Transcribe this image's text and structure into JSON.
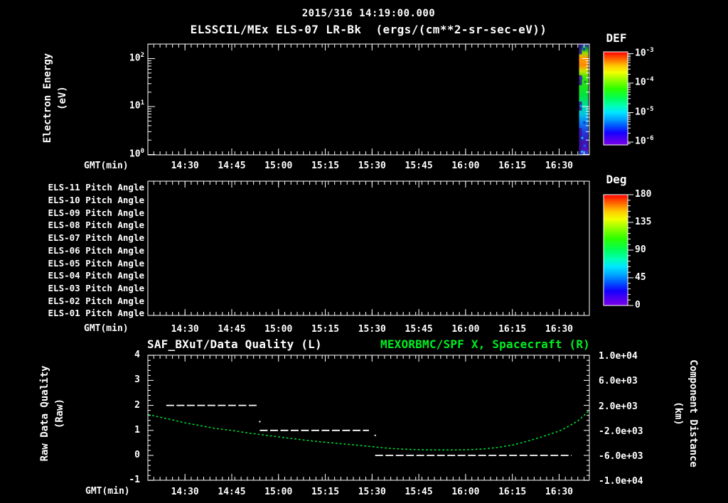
{
  "title": "2015/316 14:19:00.000",
  "subtitle": "ELSSCIL/MEx ELS-07 LR-Bk  (ergs/(cm**2-sr-sec-eV))",
  "time_axis": {
    "label": "GMT(min)",
    "major_tick_labels": [
      "14:30",
      "14:45",
      "15:00",
      "15:15",
      "15:30",
      "15:45",
      "16:00",
      "16:15",
      "16:30"
    ]
  },
  "energy_panel": {
    "y_axis_title": "Electron Energy",
    "y_axis_units": "(eV)",
    "y_tick_labels": [
      "10^0",
      "10^1",
      "10^2"
    ],
    "colorbar": {
      "title": "DEF",
      "tick_labels": [
        "10^-3",
        "10^-4",
        "10^-5",
        "10^-6"
      ]
    }
  },
  "pitch_panel": {
    "row_labels": [
      "ELS-11 Pitch Angle",
      "ELS-10 Pitch Angle",
      "ELS-09 Pitch Angle",
      "ELS-08 Pitch Angle",
      "ELS-07 Pitch Angle",
      "ELS-06 Pitch Angle",
      "ELS-05 Pitch Angle",
      "ELS-04 Pitch Angle",
      "ELS-03 Pitch Angle",
      "ELS-02 Pitch Angle",
      "ELS-01 Pitch Angle"
    ],
    "colorbar": {
      "title": "Deg",
      "tick_labels": [
        "180",
        "135",
        "90",
        "45",
        "0"
      ]
    }
  },
  "quality_panel": {
    "title_left": "SAF_BXuT/Data Quality (L)",
    "title_right": "MEXORBMC/SPF X, Spacecraft (R)",
    "y_axis_title_left": "Raw Data Quality",
    "y_axis_units_left": "(Raw)",
    "y_tick_labels_left": [
      "4",
      "3",
      "2",
      "1",
      "0",
      "-1"
    ],
    "y_axis_title_right": "Component Distance",
    "y_axis_units_right": "(km)",
    "y_tick_labels_right": [
      "1.0e+04",
      "6.0e+03",
      "2.0e+03",
      "-2.0e+03",
      "-6.0e+03",
      "-1.0e+04"
    ]
  },
  "colors": {
    "foreground": "#ffffff",
    "background": "#000000",
    "series_green": "#00e432",
    "title_green": "#00ee22",
    "speck_purple": "#3c0e9e"
  },
  "colorbar_gradient_top_to_bottom": [
    {
      "frac": 0.0,
      "color": "#ff0000"
    },
    {
      "frac": 0.08,
      "color": "#ff6a00"
    },
    {
      "frac": 0.15,
      "color": "#ffc800"
    },
    {
      "frac": 0.22,
      "color": "#f2ff00"
    },
    {
      "frac": 0.3,
      "color": "#96ff00"
    },
    {
      "frac": 0.4,
      "color": "#2aff00"
    },
    {
      "frac": 0.5,
      "color": "#00ff5a"
    },
    {
      "frac": 0.58,
      "color": "#00ffb4"
    },
    {
      "frac": 0.65,
      "color": "#00e6ff"
    },
    {
      "frac": 0.72,
      "color": "#00a8ff"
    },
    {
      "frac": 0.8,
      "color": "#0050ff"
    },
    {
      "frac": 0.87,
      "color": "#1400ff"
    },
    {
      "frac": 0.94,
      "color": "#5000f0"
    },
    {
      "frac": 1.0,
      "color": "#7a00e6"
    }
  ],
  "chart_data": [
    {
      "id": "electron_energy_spectrogram",
      "type": "heatmap",
      "title": "ELSSCIL/MEx ELS-07 LR-Bk (ergs/(cm**2-sr-sec-eV))",
      "xlabel": "GMT(min)",
      "ylabel": "Electron Energy (eV)",
      "x_range": [
        "14:18",
        "16:40"
      ],
      "x_tick_labels": [
        "14:30",
        "14:45",
        "15:00",
        "15:15",
        "15:30",
        "15:45",
        "16:00",
        "16:15",
        "16:30"
      ],
      "y_scale": "log",
      "y_range_eV": [
        1,
        200
      ],
      "colorbar": {
        "title": "DEF",
        "scale": "log",
        "tick_values": [
          0.001,
          0.0001,
          1e-05,
          1e-06
        ]
      },
      "content": "panel empty except one vertical data burst at right edge ~16:38-16:40",
      "burst_profile_top_to_bottom": [
        {
          "frac": 0.0,
          "color": "#1b2fb4"
        },
        {
          "frac": 0.045,
          "color": "#12b022"
        },
        {
          "frac": 0.08,
          "color": "#9ade00"
        },
        {
          "frac": 0.12,
          "color": "#ffa000"
        },
        {
          "frac": 0.19,
          "color": "#ff8a00"
        },
        {
          "frac": 0.24,
          "color": "#cce400"
        },
        {
          "frac": 0.3,
          "color": "#3ae600"
        },
        {
          "frac": 0.46,
          "color": "#00e43c"
        },
        {
          "frac": 0.56,
          "color": "#00dd9e"
        },
        {
          "frac": 0.64,
          "color": "#00c2ea"
        },
        {
          "frac": 0.72,
          "color": "#0b78f2"
        },
        {
          "frac": 0.81,
          "color": "#2432dc"
        },
        {
          "frac": 0.89,
          "color": "#3a16b0"
        },
        {
          "frac": 0.955,
          "color": "#4c12c4"
        },
        {
          "frac": 1.0,
          "color": "#2a5cf0"
        }
      ],
      "burst_left_speck_bands_frac": [
        [
          0.0,
          0.09
        ],
        [
          0.28,
          0.37
        ],
        [
          0.52,
          0.6
        ],
        [
          0.76,
          0.99
        ]
      ],
      "burst_noise_specks": [
        {
          "fx": 0.1,
          "fy": 0.015,
          "color": "#0a1a80"
        },
        {
          "fx": 0.55,
          "fy": 0.035,
          "color": "#123acc"
        },
        {
          "fx": 0.2,
          "fy": 0.3,
          "color": "#2244dd"
        },
        {
          "fx": 0.7,
          "fy": 0.33,
          "color": "#0e8f3a"
        },
        {
          "fx": 0.15,
          "fy": 0.55,
          "color": "#00aadd"
        },
        {
          "fx": 0.6,
          "fy": 0.7,
          "color": "#1133cc"
        },
        {
          "fx": 0.3,
          "fy": 0.84,
          "color": "#00bbee"
        },
        {
          "fx": 0.65,
          "fy": 0.91,
          "color": "#2255ee"
        },
        {
          "fx": 0.25,
          "fy": 0.965,
          "color": "#00ccee"
        }
      ]
    },
    {
      "id": "pitch_angle_panel",
      "type": "heatmap",
      "rows": [
        "ELS-11 Pitch Angle",
        "ELS-10 Pitch Angle",
        "ELS-09 Pitch Angle",
        "ELS-08 Pitch Angle",
        "ELS-07 Pitch Angle",
        "ELS-06 Pitch Angle",
        "ELS-05 Pitch Angle",
        "ELS-04 Pitch Angle",
        "ELS-03 Pitch Angle",
        "ELS-02 Pitch Angle",
        "ELS-01 Pitch Angle"
      ],
      "xlabel": "GMT(min)",
      "x_tick_labels": [
        "14:30",
        "14:45",
        "15:00",
        "15:15",
        "15:30",
        "15:45",
        "16:00",
        "16:15",
        "16:30"
      ],
      "colorbar": {
        "title": "Deg",
        "range_deg": [
          0,
          180
        ],
        "tick_values": [
          180,
          135,
          90,
          45,
          0
        ]
      },
      "content": "no data visible (empty black panel)"
    },
    {
      "id": "quality_and_spacecraft_distance",
      "type": "line",
      "xlabel": "GMT(min)",
      "x_tick_labels": [
        "14:30",
        "14:45",
        "15:00",
        "15:15",
        "15:30",
        "15:45",
        "16:00",
        "16:15",
        "16:30"
      ],
      "ylim_left": [
        -1,
        4
      ],
      "ylim_right_km": [
        -10000,
        10000
      ],
      "series": [
        {
          "name": "SAF_BXuT/Data Quality (L)",
          "axis": "left",
          "style": "white dashed step line",
          "steps": [
            {
              "value": 2,
              "from": "14:24",
              "to": "14:53"
            },
            {
              "value": 1,
              "from": "14:54",
              "to": "15:29"
            },
            {
              "value": 0,
              "from": "15:31",
              "to": "16:34"
            }
          ],
          "stray_points": [
            {
              "time": "14:54",
              "value": 1.35
            },
            {
              "time": "15:31",
              "value": 0.8
            }
          ]
        },
        {
          "name": "MEXORBMC/SPF X, Spacecraft (R)",
          "axis": "right",
          "style": "green dotted curve",
          "x_minutes_after_1400": [
            18.2,
            25,
            30,
            40,
            45,
            50,
            60,
            70,
            75,
            85,
            90,
            95,
            100,
            105,
            110,
            115,
            120,
            125,
            130,
            135,
            140,
            145,
            150,
            153,
            156,
            158,
            159.5
          ],
          "km": [
            520,
            -200,
            -800,
            -1700,
            -2000,
            -2400,
            -3050,
            -3650,
            -3900,
            -4350,
            -4600,
            -4850,
            -5000,
            -5080,
            -5120,
            -5130,
            -5100,
            -5000,
            -4750,
            -4350,
            -3700,
            -2950,
            -2100,
            -1350,
            -500,
            400,
            1150
          ]
        }
      ]
    }
  ]
}
